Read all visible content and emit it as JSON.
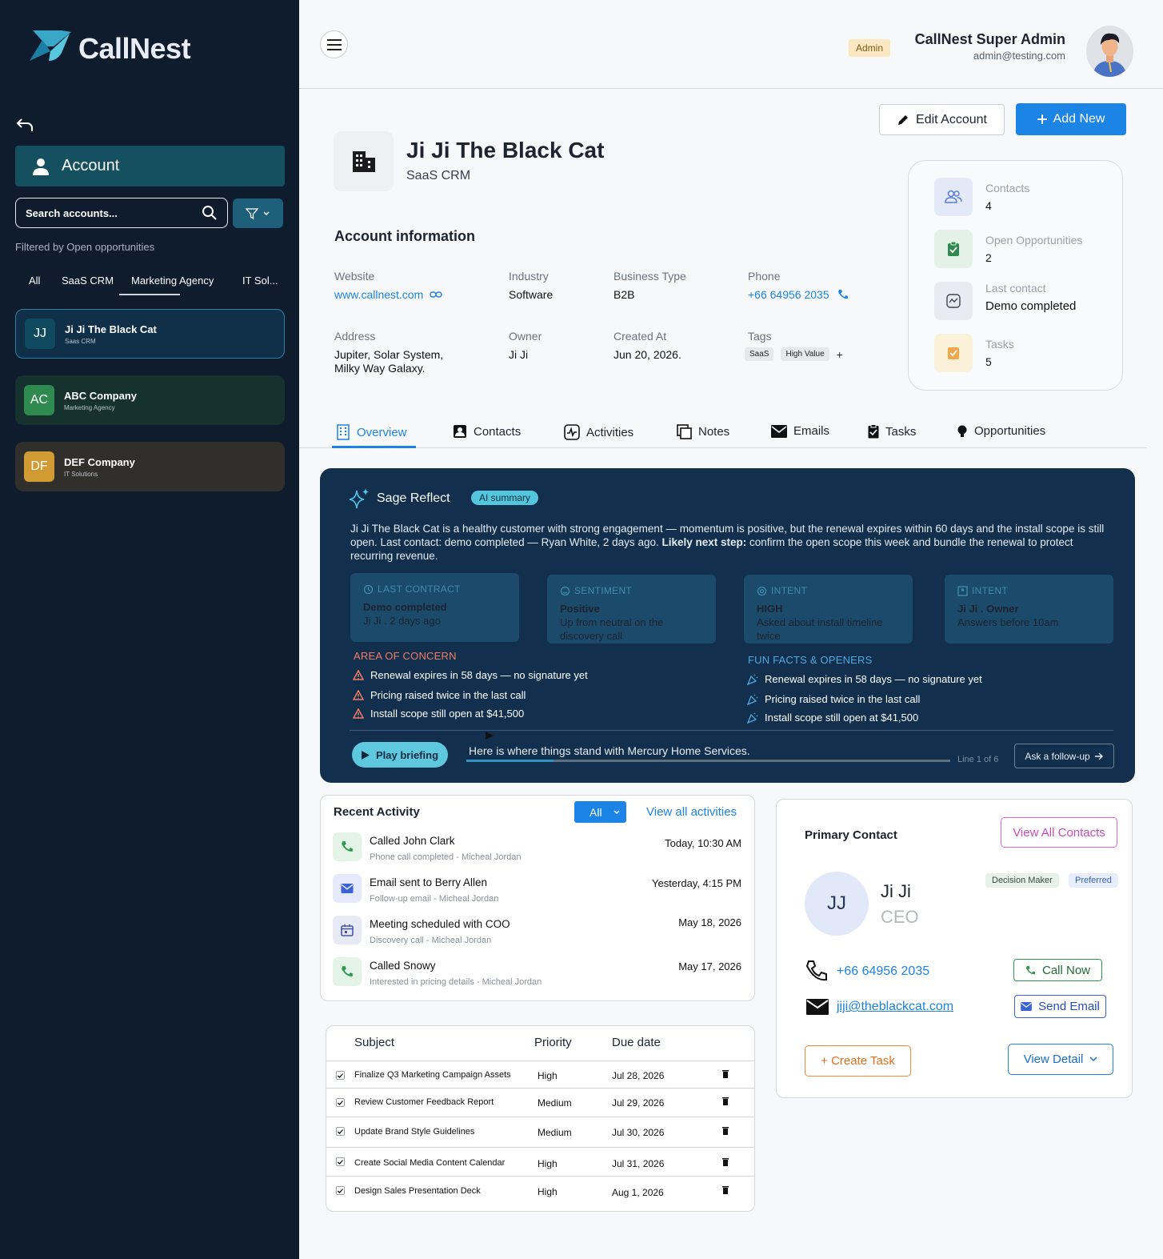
{
  "brand": {
    "name": "CallNest"
  },
  "sidebar": {
    "section_label": "Account",
    "search_placeholder": "Search accounts...",
    "filtered_by": "Filtered by Open opportunities",
    "segments": [
      "All",
      "SaaS CRM",
      "Marketing Agency",
      "IT Sol..."
    ],
    "active_segment": "Marketing Agency",
    "accounts": [
      {
        "initials": "JJ",
        "name": "Ji Ji The Black Cat",
        "sub": "Saas CRM",
        "color": "#0f4a5e",
        "selected": true
      },
      {
        "initials": "AC",
        "name": "ABC Company",
        "sub": "Marketing Agency",
        "color": "#2e8a4e"
      },
      {
        "initials": "DF",
        "name": "DEF Company",
        "sub": "IT Solutions",
        "color": "#d09b33"
      }
    ]
  },
  "header": {
    "role_badge": "Admin",
    "user_name": "CallNest Super Admin",
    "user_email": "admin@testing.com"
  },
  "actions": {
    "edit_label": "Edit Account",
    "add_label": "Add New"
  },
  "account": {
    "name": "Ji Ji The Black Cat",
    "type": "SaaS CRM",
    "info_title": "Account information",
    "fields": {
      "website_label": "Website",
      "website": "www.callnest.com",
      "industry_label": "Industry",
      "industry": "Software",
      "business_type_label": "Business Type",
      "business_type": "B2B",
      "phone_label": "Phone",
      "phone": "+66 64956 2035",
      "address_label": "Address",
      "address_line1": "Jupiter, Solar System,",
      "address_line2": "Milky Way Galaxy.",
      "owner_label": "Owner",
      "owner": "Ji Ji",
      "created_label": "Created At",
      "created": "Jun 20, 2026.",
      "tags_label": "Tags",
      "tags": [
        "SaaS",
        "High Value"
      ],
      "tag_add": "+"
    }
  },
  "stats": [
    {
      "label": "Contacts",
      "value": "4",
      "icon": "contacts-icon",
      "bg": "#e4e9f8"
    },
    {
      "label": "Open Opportunities",
      "value": "2",
      "icon": "clipboard-icon",
      "bg": "#e3f1e7"
    },
    {
      "label": "Last contact",
      "value": "Demo completed",
      "icon": "activity-icon",
      "bg": "#e8ebf2"
    },
    {
      "label": "Tasks",
      "value": "5",
      "icon": "task-icon",
      "bg": "#fbf1d9"
    }
  ],
  "tabs": [
    "Overview",
    "Contacts",
    "Activities",
    "Notes",
    "Emails",
    "Tasks",
    "Opportunities"
  ],
  "sage": {
    "title": "Sage Reflect",
    "pill": "AI summary",
    "summary_a": "Ji Ji The Black Cat is a healthy customer with strong engagement — momentum is positive, but the renewal expires within 60 days and the install scope is still open. Last contact: demo completed — Ryan White, 2 days ago. ",
    "summary_bold": "Likely next step:",
    "summary_b": " confirm the open scope this week and bundle the renewal to protect recurring revenue.",
    "tiles": [
      {
        "head": "LAST CONTRACT",
        "l1": "Demo completed",
        "l2": "Ji Ji . 2 days ago",
        "icon": "history-icon"
      },
      {
        "head": "SENTIMENT",
        "l1": "Positive",
        "l2": "Up from neutral on the discovery call",
        "icon": "smile-icon"
      },
      {
        "head": "INTENT",
        "l1": "HIGH",
        "l2": "Asked about install timeline twice",
        "icon": "target-icon"
      },
      {
        "head": "INTENT",
        "l1": "Ji Ji . Owner",
        "l2": "Answers before 10am",
        "icon": "person-card-icon"
      }
    ],
    "concern_title": "AREA OF CONCERN",
    "concerns": [
      "Renewal expires in 58 days — no signature yet",
      "Pricing raised twice in the last call",
      "Install scope still open at $41,500"
    ],
    "fun_title": "FUN FACTS & OPENERS",
    "fun": [
      "Renewal expires in 58 days — no signature yet",
      "Pricing raised twice in the last call",
      "Install scope still open at $41,500"
    ],
    "play_label": "Play briefing",
    "briefing_text": "Here is where things stand with Mercury Home Services.",
    "line_counter": "Line 1 of 6",
    "progress": 0.18,
    "ask_label": "Ask a follow-up"
  },
  "activity": {
    "title": "Recent Activity",
    "filter": "All",
    "view_all": "View all activities",
    "items": [
      {
        "title": "Called John Clark",
        "sub": "Phone call completed - Micheal Jordan",
        "date": "Today, 10:30 AM",
        "icon": "phone-icon",
        "bg": "#e3f3e6",
        "fg": "#2e9a4e"
      },
      {
        "title": "Email sent to Berry Allen",
        "sub": "Follow-up email - Micheal Jordan",
        "date": "Yesterday, 4:15 PM",
        "icon": "mail-icon",
        "bg": "#e4eafb",
        "fg": "#3a63d9"
      },
      {
        "title": "Meeting scheduled with COO",
        "sub": "Discovery call - Micheal Jordan",
        "date": "May 18, 2026",
        "icon": "calendar-icon",
        "bg": "#e7e9f4",
        "fg": "#4a55a8"
      },
      {
        "title": "Called Snowy",
        "sub": "Interested in pricing details - Micheal Jordan",
        "date": "May 17, 2026",
        "icon": "phone-icon",
        "bg": "#e3f3e6",
        "fg": "#2e9a4e"
      }
    ]
  },
  "tasks": {
    "headers": [
      "Subject",
      "Priority",
      "Due date"
    ],
    "rows": [
      {
        "subject": "Finalize Q3 Marketing Campaign Assets",
        "priority": "High",
        "due": "Jul 28, 2026"
      },
      {
        "subject": "Review Customer Feedback Report",
        "priority": "Medium",
        "due": "Jul 29, 2026"
      },
      {
        "subject": "Update Brand Style Guidelines",
        "priority": "Medium",
        "due": "Jul 30, 2026"
      },
      {
        "subject": "Create Social Media Content Calendar",
        "priority": "High",
        "due": "Jul 31, 2026"
      },
      {
        "subject": "Design Sales Presentation Deck",
        "priority": "High",
        "due": "Aug 1, 2026"
      }
    ]
  },
  "contact": {
    "title": "Primary Contact",
    "view_all": "View All Contacts",
    "initials": "JJ",
    "name": "Ji Ji",
    "role": "CEO",
    "badges": [
      "Decision Maker",
      "Preferred"
    ],
    "phone": "+66 64956 2035",
    "email": "jiji@theblackcat.com",
    "call_label": "Call Now",
    "email_label": "Send Email",
    "create_task": "+ Create Task",
    "view_detail": "View Detail"
  }
}
